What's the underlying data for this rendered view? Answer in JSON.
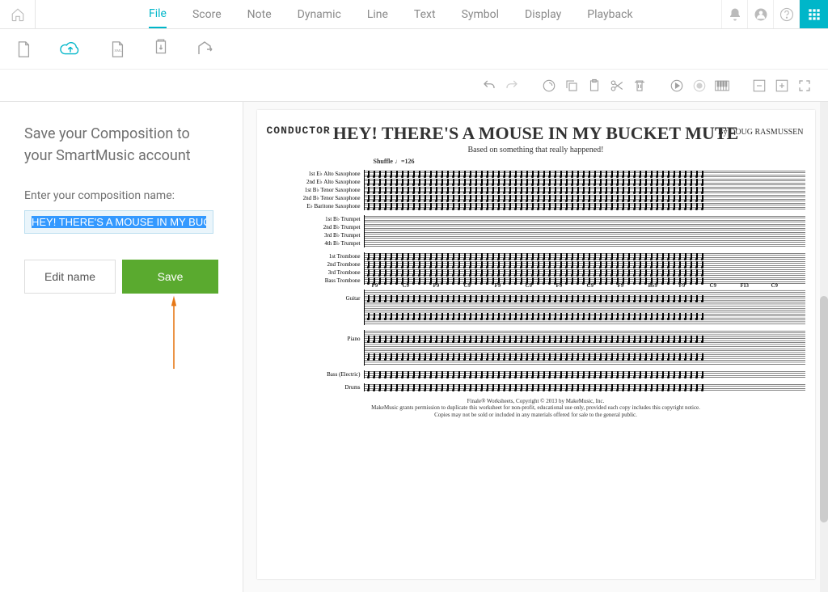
{
  "topbar": {
    "tabs": [
      "File",
      "Score",
      "Note",
      "Dynamic",
      "Line",
      "Text",
      "Symbol",
      "Display",
      "Playback"
    ],
    "active_tab": "File"
  },
  "sidebar": {
    "heading": "Save your Composition to your SmartMusic account",
    "input_label": "Enter your composition name:",
    "input_value": "HEY! THERE'S A MOUSE IN MY BUCKET MUTE",
    "edit_label": "Edit name",
    "save_label": "Save"
  },
  "score": {
    "conductor_label": "CONDUCTOR",
    "title": "HEY! THERE'S A MOUSE IN MY BUCKET MUTE",
    "byline": "By DOUG RASMUSSEN",
    "subtitle": "Based on something that really happened!",
    "tempo": "Shuffle ♩=126",
    "instruments_group1": [
      "1st E♭ Alto Saxophone",
      "2nd E♭ Alto Saxophone",
      "1st B♭ Tenor Saxophone",
      "2nd B♭ Tenor Saxophone",
      "E♭ Baritone Saxophone"
    ],
    "instruments_group2": [
      "1st B♭ Trumpet",
      "2nd B♭ Trumpet",
      "3rd B♭ Trumpet",
      "4th B♭ Trumpet"
    ],
    "instruments_group3": [
      "1st Trombone",
      "2nd Trombone",
      "3rd Trombone",
      "Bass Trombone"
    ],
    "instruments_group4": [
      "Guitar"
    ],
    "instruments_group5": [
      "Piano"
    ],
    "instruments_group6": [
      "Bass (Electric)"
    ],
    "instruments_group7": [
      "Drums"
    ],
    "chords": [
      "F9",
      "C9",
      "F9",
      "C9",
      "F9",
      "C9",
      "F9",
      "C9",
      "F9",
      "B♭9",
      "F9",
      "C9",
      "FI3",
      "C9"
    ],
    "copyright_line1": "Finale® Worksheets, Copyright © 2013 by MakeMusic, Inc.",
    "copyright_line2": "MakeMusic grants permission to duplicate this worksheet for non-profit, educational use only, provided each copy includes this copyright notice.",
    "copyright_line3": "Copies may not be sold or included in any materials offered for sale to the general public."
  },
  "colors": {
    "accent": "#00b6c9",
    "save_green": "#5aaa2f",
    "arrow_orange": "#e67817"
  }
}
